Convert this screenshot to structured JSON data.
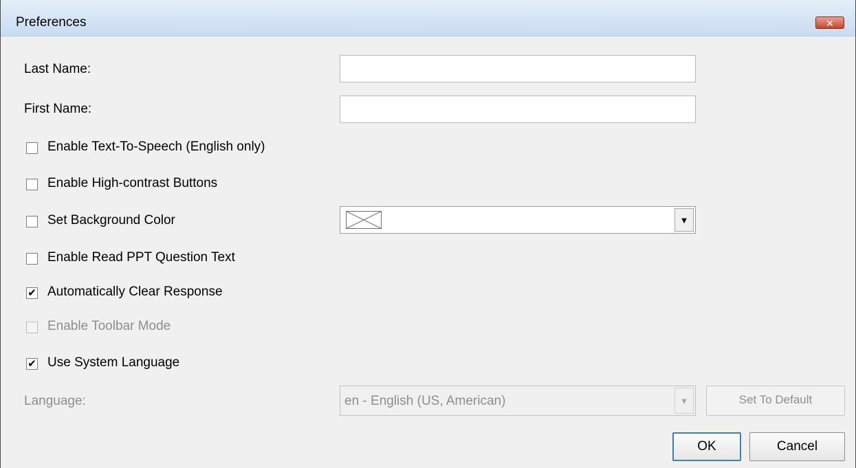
{
  "window": {
    "title": "Preferences",
    "close_glyph": "✕"
  },
  "fields": {
    "last_name": {
      "label": "Last Name:",
      "value": ""
    },
    "first_name": {
      "label": "First Name:",
      "value": ""
    }
  },
  "options": [
    {
      "label": "Enable Text-To-Speech (English only)",
      "checked": false,
      "enabled": true
    },
    {
      "label": "Enable High-contrast Buttons",
      "checked": false,
      "enabled": true
    },
    {
      "label": "Set Background Color",
      "checked": false,
      "enabled": true
    },
    {
      "label": "Enable Read PPT Question Text",
      "checked": false,
      "enabled": true
    },
    {
      "label": "Automatically Clear Response",
      "checked": true,
      "enabled": true
    },
    {
      "label": "Enable Toolbar Mode",
      "checked": false,
      "enabled": false
    },
    {
      "label": "Use System Language",
      "checked": true,
      "enabled": true
    }
  ],
  "background_color": {
    "selected_icon": "empty-swatch-icon",
    "arrow_glyph": "▼"
  },
  "language": {
    "label": "Language:",
    "selected": "en - English (US, American)",
    "arrow_glyph": "▼",
    "set_default_label": "Set To Default"
  },
  "footer": {
    "ok_label": "OK",
    "cancel_label": "Cancel"
  },
  "check_glyph": "✔",
  "colors": {
    "titlebar": "#c9dcf2",
    "close_button": "#c8462c",
    "disabled_text": "#8d8d8d"
  }
}
